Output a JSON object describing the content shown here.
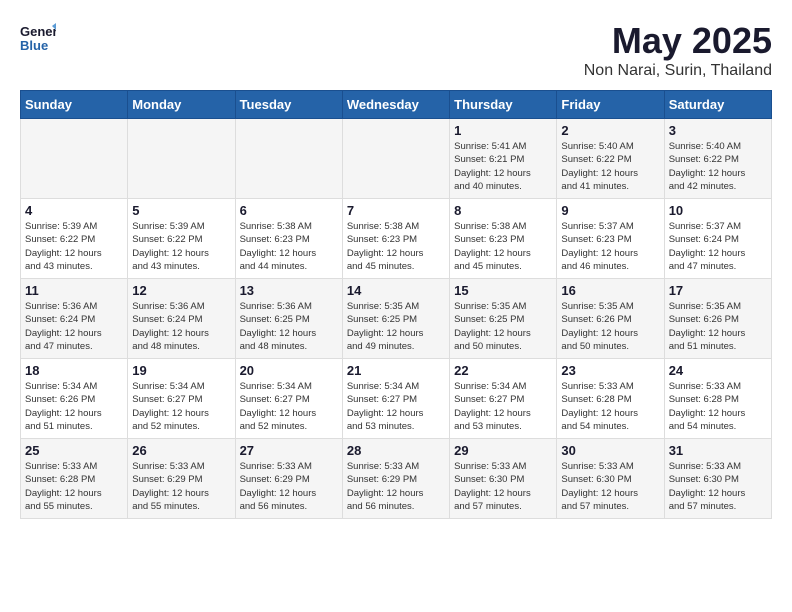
{
  "header": {
    "logo_line1": "General",
    "logo_line2": "Blue",
    "month": "May 2025",
    "location": "Non Narai, Surin, Thailand"
  },
  "weekdays": [
    "Sunday",
    "Monday",
    "Tuesday",
    "Wednesday",
    "Thursday",
    "Friday",
    "Saturday"
  ],
  "weeks": [
    [
      {
        "day": "",
        "info": ""
      },
      {
        "day": "",
        "info": ""
      },
      {
        "day": "",
        "info": ""
      },
      {
        "day": "",
        "info": ""
      },
      {
        "day": "1",
        "info": "Sunrise: 5:41 AM\nSunset: 6:21 PM\nDaylight: 12 hours\nand 40 minutes."
      },
      {
        "day": "2",
        "info": "Sunrise: 5:40 AM\nSunset: 6:22 PM\nDaylight: 12 hours\nand 41 minutes."
      },
      {
        "day": "3",
        "info": "Sunrise: 5:40 AM\nSunset: 6:22 PM\nDaylight: 12 hours\nand 42 minutes."
      }
    ],
    [
      {
        "day": "4",
        "info": "Sunrise: 5:39 AM\nSunset: 6:22 PM\nDaylight: 12 hours\nand 43 minutes."
      },
      {
        "day": "5",
        "info": "Sunrise: 5:39 AM\nSunset: 6:22 PM\nDaylight: 12 hours\nand 43 minutes."
      },
      {
        "day": "6",
        "info": "Sunrise: 5:38 AM\nSunset: 6:23 PM\nDaylight: 12 hours\nand 44 minutes."
      },
      {
        "day": "7",
        "info": "Sunrise: 5:38 AM\nSunset: 6:23 PM\nDaylight: 12 hours\nand 45 minutes."
      },
      {
        "day": "8",
        "info": "Sunrise: 5:38 AM\nSunset: 6:23 PM\nDaylight: 12 hours\nand 45 minutes."
      },
      {
        "day": "9",
        "info": "Sunrise: 5:37 AM\nSunset: 6:23 PM\nDaylight: 12 hours\nand 46 minutes."
      },
      {
        "day": "10",
        "info": "Sunrise: 5:37 AM\nSunset: 6:24 PM\nDaylight: 12 hours\nand 47 minutes."
      }
    ],
    [
      {
        "day": "11",
        "info": "Sunrise: 5:36 AM\nSunset: 6:24 PM\nDaylight: 12 hours\nand 47 minutes."
      },
      {
        "day": "12",
        "info": "Sunrise: 5:36 AM\nSunset: 6:24 PM\nDaylight: 12 hours\nand 48 minutes."
      },
      {
        "day": "13",
        "info": "Sunrise: 5:36 AM\nSunset: 6:25 PM\nDaylight: 12 hours\nand 48 minutes."
      },
      {
        "day": "14",
        "info": "Sunrise: 5:35 AM\nSunset: 6:25 PM\nDaylight: 12 hours\nand 49 minutes."
      },
      {
        "day": "15",
        "info": "Sunrise: 5:35 AM\nSunset: 6:25 PM\nDaylight: 12 hours\nand 50 minutes."
      },
      {
        "day": "16",
        "info": "Sunrise: 5:35 AM\nSunset: 6:26 PM\nDaylight: 12 hours\nand 50 minutes."
      },
      {
        "day": "17",
        "info": "Sunrise: 5:35 AM\nSunset: 6:26 PM\nDaylight: 12 hours\nand 51 minutes."
      }
    ],
    [
      {
        "day": "18",
        "info": "Sunrise: 5:34 AM\nSunset: 6:26 PM\nDaylight: 12 hours\nand 51 minutes."
      },
      {
        "day": "19",
        "info": "Sunrise: 5:34 AM\nSunset: 6:27 PM\nDaylight: 12 hours\nand 52 minutes."
      },
      {
        "day": "20",
        "info": "Sunrise: 5:34 AM\nSunset: 6:27 PM\nDaylight: 12 hours\nand 52 minutes."
      },
      {
        "day": "21",
        "info": "Sunrise: 5:34 AM\nSunset: 6:27 PM\nDaylight: 12 hours\nand 53 minutes."
      },
      {
        "day": "22",
        "info": "Sunrise: 5:34 AM\nSunset: 6:27 PM\nDaylight: 12 hours\nand 53 minutes."
      },
      {
        "day": "23",
        "info": "Sunrise: 5:33 AM\nSunset: 6:28 PM\nDaylight: 12 hours\nand 54 minutes."
      },
      {
        "day": "24",
        "info": "Sunrise: 5:33 AM\nSunset: 6:28 PM\nDaylight: 12 hours\nand 54 minutes."
      }
    ],
    [
      {
        "day": "25",
        "info": "Sunrise: 5:33 AM\nSunset: 6:28 PM\nDaylight: 12 hours\nand 55 minutes."
      },
      {
        "day": "26",
        "info": "Sunrise: 5:33 AM\nSunset: 6:29 PM\nDaylight: 12 hours\nand 55 minutes."
      },
      {
        "day": "27",
        "info": "Sunrise: 5:33 AM\nSunset: 6:29 PM\nDaylight: 12 hours\nand 56 minutes."
      },
      {
        "day": "28",
        "info": "Sunrise: 5:33 AM\nSunset: 6:29 PM\nDaylight: 12 hours\nand 56 minutes."
      },
      {
        "day": "29",
        "info": "Sunrise: 5:33 AM\nSunset: 6:30 PM\nDaylight: 12 hours\nand 57 minutes."
      },
      {
        "day": "30",
        "info": "Sunrise: 5:33 AM\nSunset: 6:30 PM\nDaylight: 12 hours\nand 57 minutes."
      },
      {
        "day": "31",
        "info": "Sunrise: 5:33 AM\nSunset: 6:30 PM\nDaylight: 12 hours\nand 57 minutes."
      }
    ]
  ]
}
